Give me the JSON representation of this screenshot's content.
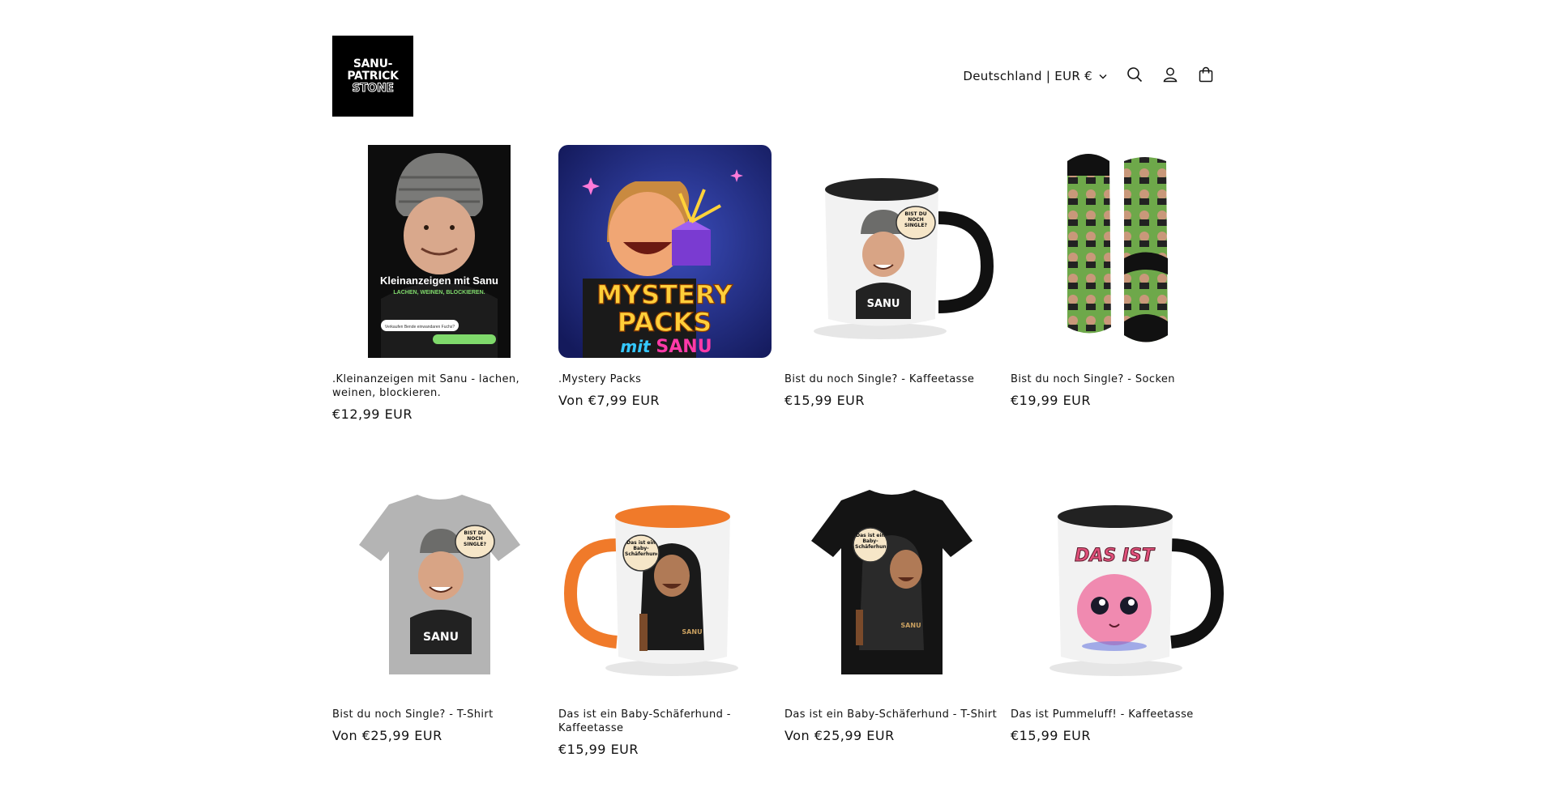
{
  "brand": {
    "lines": [
      "SANU-",
      "PATRICK",
      "STONE"
    ]
  },
  "header": {
    "locale_label": "Deutschland | EUR €"
  },
  "products": [
    {
      "title": ".Kleinanzeigen mit Sanu - lachen, weinen, blockieren.",
      "price": "€12,99 EUR",
      "image_text": [
        "Kleinanzeigen mit Sanu",
        "LACHEN, WEINEN, BLOCKIEREN.",
        "Verkaufen Bende einwandaren Fuchs?"
      ]
    },
    {
      "title": ".Mystery Packs",
      "price": "Von €7,99 EUR",
      "image_text": [
        "MYSTERY",
        "PACKS",
        "mit",
        "SANU"
      ]
    },
    {
      "title": "Bist du noch Single? - Kaffeetasse",
      "price": "€15,99 EUR",
      "image_text": [
        "BIST DU NOCH SINGLE?",
        "SANU"
      ]
    },
    {
      "title": "Bist du noch Single? - Socken",
      "price": "€19,99 EUR",
      "image_text": []
    },
    {
      "title": "Bist du noch Single? - T-Shirt",
      "price": "Von €25,99 EUR",
      "image_text": [
        "BIST DU NOCH SINGLE?",
        "SANU"
      ]
    },
    {
      "title": "Das ist ein Baby-Schäferhund - Kaffeetasse",
      "price": "€15,99 EUR",
      "image_text": [
        "Das ist ein Baby-Schäferhund",
        "SANU"
      ]
    },
    {
      "title": "Das ist ein Baby-Schäferhund - T-Shirt",
      "price": "Von €25,99 EUR",
      "image_text": [
        "Das ist ein Baby-Schäferhund",
        "SANU"
      ]
    },
    {
      "title": "Das ist Pummeluff! - Kaffeetasse",
      "price": "€15,99 EUR",
      "image_text": [
        "DAS IST"
      ]
    }
  ]
}
